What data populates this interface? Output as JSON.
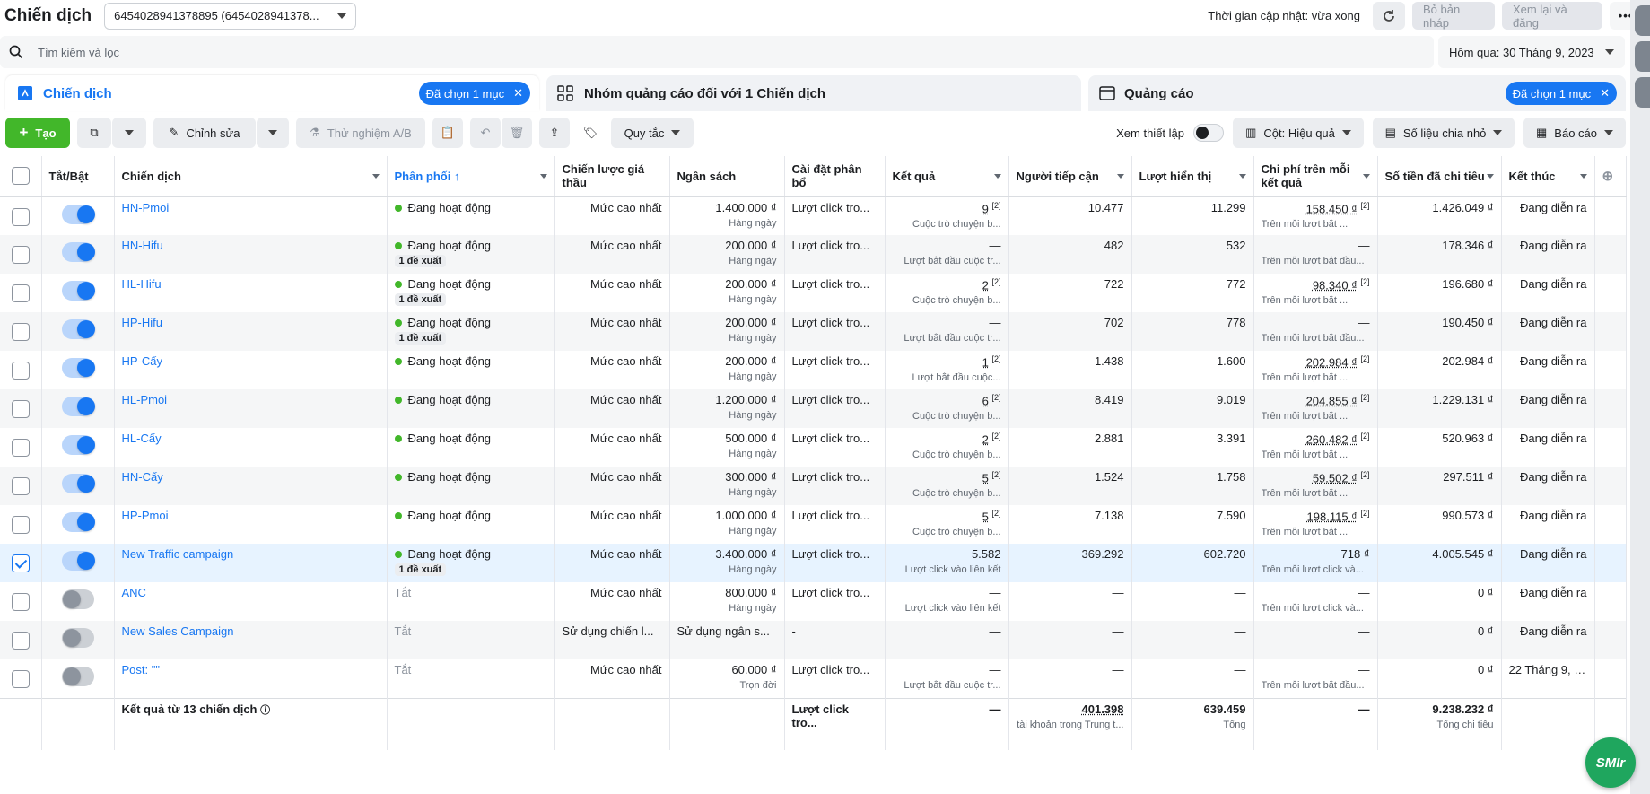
{
  "header": {
    "title": "Chiến dịch",
    "account": "6454028941378895 (6454028941378...",
    "update_time": "Thời gian cập nhật: vừa xong",
    "discard_draft": "Bỏ bản nháp",
    "review_publish": "Xem lại và đăng"
  },
  "search": {
    "placeholder": "Tìm kiếm và lọc"
  },
  "date_range": "Hôm qua: 30 Tháng 9, 2023",
  "tabs": [
    {
      "label": "Chiến dịch",
      "pill": "Đã chọn 1 mục"
    },
    {
      "label": "Nhóm quảng cáo đối với 1 Chiến dịch"
    },
    {
      "label": "Quảng cáo",
      "pill": "Đã chọn 1 mục"
    }
  ],
  "toolbar": {
    "create": "Tạo",
    "edit": "Chỉnh sửa",
    "ab_test": "Thử nghiệm A/B",
    "rules": "Quy tắc",
    "view_setup": "Xem thiết lập",
    "columns": "Cột: Hiệu quả",
    "breakdown": "Số liệu chia nhỏ",
    "reports": "Báo cáo"
  },
  "columns": [
    "Tắt/Bật",
    "Chiến dịch",
    "Phân phối ↑",
    "Chiến lược giá thầu",
    "Ngân sách",
    "Cài đặt phân bổ",
    "Kết quả",
    "Người tiếp cận",
    "Lượt hiển thị",
    "Chi phí trên mỗi kết quả",
    "Số tiền đã chi tiêu",
    "Kết thúc"
  ],
  "rows": [
    {
      "name": "HN-Pmoi",
      "delivery": "Đang hoạt động",
      "suggest": "",
      "bid": "Mức cao nhất",
      "budget": "1.400.000 ₫",
      "budget_type": "Hàng ngày",
      "attr": "Lượt click tro...",
      "result": "9",
      "result_sub": "Cuộc trò chuyện b...",
      "reach": "10.477",
      "impr": "11.299",
      "cpr": "158.450 ₫",
      "cpr_sub": "Trên mỗi lượt bắt ...",
      "spent": "1.426.049 ₫",
      "end": "Đang diễn ra",
      "on": true
    },
    {
      "name": "HN-Hifu",
      "delivery": "Đang hoạt động",
      "suggest": "1 đề xuất",
      "bid": "Mức cao nhất",
      "budget": "200.000 ₫",
      "budget_type": "Hàng ngày",
      "attr": "Lượt click tro...",
      "result": "—",
      "result_sub": "Lượt bắt đầu cuộc tr...",
      "reach": "482",
      "impr": "532",
      "cpr": "—",
      "cpr_sub": "Trên mỗi lượt bắt đầu...",
      "spent": "178.346 ₫",
      "end": "Đang diễn ra",
      "on": true
    },
    {
      "name": "HL-Hifu",
      "delivery": "Đang hoạt động",
      "suggest": "1 đề xuất",
      "bid": "Mức cao nhất",
      "budget": "200.000 ₫",
      "budget_type": "Hàng ngày",
      "attr": "Lượt click tro...",
      "result": "2",
      "result_sub": "Cuộc trò chuyện b...",
      "reach": "722",
      "impr": "772",
      "cpr": "98.340 ₫",
      "cpr_sub": "Trên mỗi lượt bắt ...",
      "spent": "196.680 ₫",
      "end": "Đang diễn ra",
      "on": true
    },
    {
      "name": "HP-Hifu",
      "delivery": "Đang hoạt động",
      "suggest": "1 đề xuất",
      "bid": "Mức cao nhất",
      "budget": "200.000 ₫",
      "budget_type": "Hàng ngày",
      "attr": "Lượt click tro...",
      "result": "—",
      "result_sub": "Lượt bắt đầu cuộc tr...",
      "reach": "702",
      "impr": "778",
      "cpr": "—",
      "cpr_sub": "Trên mỗi lượt bắt đầu...",
      "spent": "190.450 ₫",
      "end": "Đang diễn ra",
      "on": true
    },
    {
      "name": "HP-Cấy",
      "delivery": "Đang hoạt động",
      "suggest": "",
      "bid": "Mức cao nhất",
      "budget": "200.000 ₫",
      "budget_type": "Hàng ngày",
      "attr": "Lượt click tro...",
      "result": "1",
      "result_sub": "Lượt bắt đầu cuộc...",
      "reach": "1.438",
      "impr": "1.600",
      "cpr": "202.984 ₫",
      "cpr_sub": "Trên mỗi lượt bắt ...",
      "spent": "202.984 ₫",
      "end": "Đang diễn ra",
      "on": true
    },
    {
      "name": "HL-Pmoi",
      "delivery": "Đang hoạt động",
      "suggest": "",
      "bid": "Mức cao nhất",
      "budget": "1.200.000 ₫",
      "budget_type": "Hàng ngày",
      "attr": "Lượt click tro...",
      "result": "6",
      "result_sub": "Cuộc trò chuyện b...",
      "reach": "8.419",
      "impr": "9.019",
      "cpr": "204.855 ₫",
      "cpr_sub": "Trên mỗi lượt bắt ...",
      "spent": "1.229.131 ₫",
      "end": "Đang diễn ra",
      "on": true
    },
    {
      "name": "HL-Cấy",
      "delivery": "Đang hoạt động",
      "suggest": "",
      "bid": "Mức cao nhất",
      "budget": "500.000 ₫",
      "budget_type": "Hàng ngày",
      "attr": "Lượt click tro...",
      "result": "2",
      "result_sub": "Cuộc trò chuyện b...",
      "reach": "2.881",
      "impr": "3.391",
      "cpr": "260.482 ₫",
      "cpr_sub": "Trên mỗi lượt bắt ...",
      "spent": "520.963 ₫",
      "end": "Đang diễn ra",
      "on": true
    },
    {
      "name": "HN-Cấy",
      "delivery": "Đang hoạt động",
      "suggest": "",
      "bid": "Mức cao nhất",
      "budget": "300.000 ₫",
      "budget_type": "Hàng ngày",
      "attr": "Lượt click tro...",
      "result": "5",
      "result_sub": "Cuộc trò chuyện b...",
      "reach": "1.524",
      "impr": "1.758",
      "cpr": "59.502 ₫",
      "cpr_sub": "Trên mỗi lượt bắt ...",
      "spent": "297.511 ₫",
      "end": "Đang diễn ra",
      "on": true
    },
    {
      "name": "HP-Pmoi",
      "delivery": "Đang hoạt động",
      "suggest": "",
      "bid": "Mức cao nhất",
      "budget": "1.000.000 ₫",
      "budget_type": "Hàng ngày",
      "attr": "Lượt click tro...",
      "result": "5",
      "result_sub": "Cuộc trò chuyện b...",
      "reach": "7.138",
      "impr": "7.590",
      "cpr": "198.115 ₫",
      "cpr_sub": "Trên mỗi lượt bắt ...",
      "spent": "990.573 ₫",
      "end": "Đang diễn ra",
      "on": true
    },
    {
      "name": "New Traffic campaign",
      "delivery": "Đang hoạt động",
      "suggest": "1 đề xuất",
      "bid": "Mức cao nhất",
      "budget": "3.400.000 ₫",
      "budget_type": "Hàng ngày",
      "attr": "Lượt click tro...",
      "result": "5.582",
      "result_sub": "Lượt click vào liên kết",
      "reach": "369.292",
      "impr": "602.720",
      "cpr": "718 ₫",
      "cpr_sub": "Trên mỗi lượt click và...",
      "spent": "4.005.545 ₫",
      "end": "Đang diễn ra",
      "on": true,
      "selected": true
    },
    {
      "name": "ANC",
      "delivery": "Tắt",
      "suggest": "",
      "bid": "Mức cao nhất",
      "budget": "800.000 ₫",
      "budget_type": "Hàng ngày",
      "attr": "Lượt click tro...",
      "result": "—",
      "result_sub": "Lượt click vào liên kết",
      "reach": "—",
      "impr": "—",
      "cpr": "—",
      "cpr_sub": "Trên mỗi lượt click và...",
      "spent": "0 ₫",
      "end": "Đang diễn ra",
      "on": false
    },
    {
      "name": "New Sales Campaign",
      "delivery": "Tắt",
      "suggest": "",
      "bid": "Sử dụng chiến l...",
      "budget": "Sử dụng ngân s...",
      "budget_type": "",
      "attr": "-",
      "result": "—",
      "result_sub": "",
      "reach": "—",
      "impr": "—",
      "cpr": "—",
      "cpr_sub": "",
      "spent": "0 ₫",
      "end": "Đang diễn ra",
      "on": false
    },
    {
      "name": "Post: \"\"",
      "delivery": "Tắt",
      "suggest": "",
      "bid": "Mức cao nhất",
      "budget": "60.000 ₫",
      "budget_type": "Trọn đời",
      "attr": "Lượt click tro...",
      "result": "—",
      "result_sub": "Lượt bắt đầu cuộc tr...",
      "reach": "—",
      "impr": "—",
      "cpr": "—",
      "cpr_sub": "Trên mỗi lượt bắt đầu...",
      "spent": "0 ₫",
      "end": "22 Tháng 9, 20...",
      "on": false
    }
  ],
  "footer": {
    "label": "Kết quả từ 13 chiến dịch",
    "attr": "Lượt click tro...",
    "result": "—",
    "reach": "401.398",
    "reach_sub": "tài khoản trong Trung t...",
    "impr": "639.459",
    "impr_sub": "Tổng",
    "cpr": "—",
    "spent": "9.238.232 ₫",
    "spent_sub": "Tổng chi tiêu"
  },
  "chat_widget": "SMIr",
  "colors": {
    "accent": "#1877f2",
    "create": "#42b72a",
    "active_dot": "#42b72a"
  }
}
